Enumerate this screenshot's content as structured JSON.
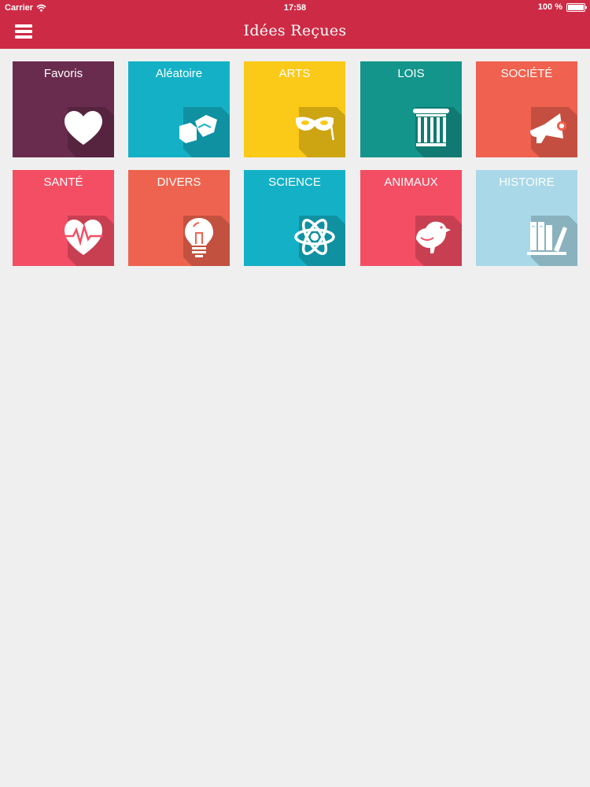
{
  "status_bar": {
    "carrier": "Carrier",
    "time": "17:58",
    "battery": "100 %"
  },
  "nav": {
    "title": "Idées Reçues"
  },
  "colors": {
    "bar": "#cd2b45",
    "background": "#efefef"
  },
  "tiles": [
    {
      "label": "Favoris",
      "icon": "heart-icon",
      "color": "#6a2c4e"
    },
    {
      "label": "Aléatoire",
      "icon": "dice-icon",
      "color": "#14b1c6"
    },
    {
      "label": "ARTS",
      "icon": "mask-icon",
      "color": "#fbc917"
    },
    {
      "label": "LOIS",
      "icon": "column-icon",
      "color": "#14958b"
    },
    {
      "label": "SOCIÉTÉ",
      "icon": "megaphone-icon",
      "color": "#f0614f"
    },
    {
      "label": "SANTÉ",
      "icon": "heartbeat-icon",
      "color": "#f44e64"
    },
    {
      "label": "DIVERS",
      "icon": "lightbulb-icon",
      "color": "#ee634f"
    },
    {
      "label": "SCIENCE",
      "icon": "atom-icon",
      "color": "#14b1c6"
    },
    {
      "label": "ANIMAUX",
      "icon": "bird-icon",
      "color": "#f44e64"
    },
    {
      "label": "HISTOIRE",
      "icon": "books-icon",
      "color": "#a9d8e8"
    }
  ]
}
